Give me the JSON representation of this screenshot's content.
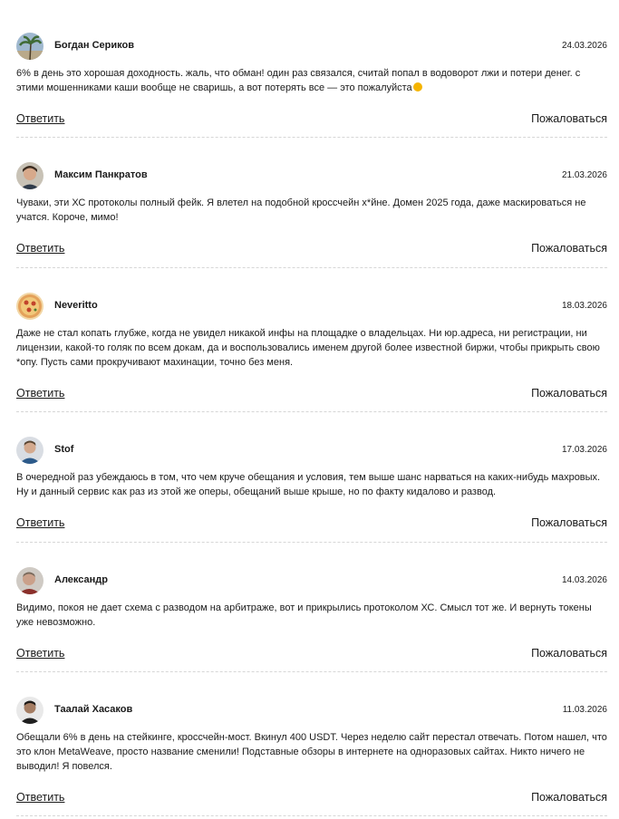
{
  "comments": [
    {
      "author": "Богдан Сериков",
      "date": "24.03.2026",
      "text": "6% в день это хорошая доходность. жаль, что обман! один раз связался, считай попал в водоворот лжи и потери денег. с этими мошенниками каши вообще не сваришь, а вот потерять все — это пожалуйста",
      "emoji": "sad-face-emoji",
      "reply_label": "Ответить",
      "report_label": "Пожаловаться",
      "avatar_icon": "avatar-palm-photo"
    },
    {
      "author": "Максим Панкратов",
      "date": "21.03.2026",
      "text": "Чуваки, эти ХС протоколы полный фейк. Я влетел на подобной кроссчейн х*йне. Домен 2025 года, даже маскироваться не учатся. Короче, мимо!",
      "reply_label": "Ответить",
      "report_label": "Пожаловаться",
      "avatar_icon": "avatar-man-photo"
    },
    {
      "author": "Neveritto",
      "date": "18.03.2026",
      "text": "Даже не стал копать глубже, когда не увидел никакой инфы на площадке о владельцах. Ни юр.адреса, ни регистрации, ни лицензии, какой-то голяк по всем докам, да и воспользовались именем другой более известной биржи, чтобы прикрыть свою *опу. Пусть сами прокручивают махинации, точно без меня.",
      "reply_label": "Ответить",
      "report_label": "Пожаловаться",
      "avatar_icon": "avatar-pizza-photo"
    },
    {
      "author": "Stof",
      "date": "17.03.2026",
      "text": "В очередной раз убеждаюсь в том, что чем круче обещания и условия, тем выше шанс нарваться на каких-нибудь махровых. Ну и данный сервис как раз из этой же оперы, обещаний выше крыше, но по факту кидалово и развод.",
      "reply_label": "Ответить",
      "report_label": "Пожаловаться",
      "avatar_icon": "avatar-man-photo"
    },
    {
      "author": "Александр",
      "date": "14.03.2026",
      "text": "Видимо, покоя не дает схема с разводом на арбитраже, вот и прикрылись протоколом ХС. Смысл тот же. И вернуть токены уже невозможно.",
      "reply_label": "Ответить",
      "report_label": "Пожаловаться",
      "avatar_icon": "avatar-man-photo"
    },
    {
      "author": "Таалай Хасаков",
      "date": "11.03.2026",
      "text": "Обещали 6% в день на стейкинге, кроссчейн-мост. Вкинул 400 USDT. Через неделю сайт перестал отвечать. Потом нашел, что это клон MetaWeave, просто название сменили! Подставные обзоры в интернете на одноразовых сайтах. Никто ничего не выводил! Я повелся.",
      "reply_label": "Ответить",
      "report_label": "Пожаловаться",
      "avatar_icon": "avatar-man-dark-photo"
    }
  ]
}
